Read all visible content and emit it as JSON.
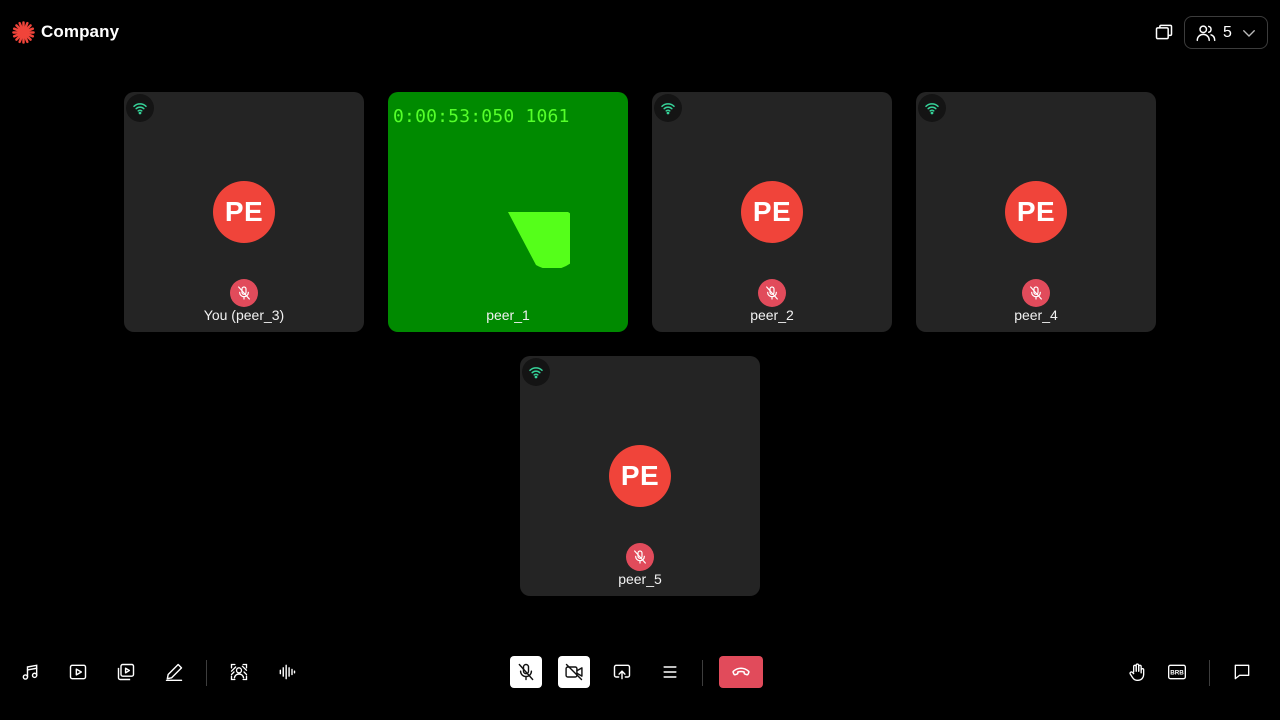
{
  "brand": {
    "name": "Company",
    "logo_icon": "asterisk-logo-icon",
    "logo_color": "#f0443a"
  },
  "header": {
    "pip_icon": "picture-in-picture-icon",
    "participants_icon": "people-icon",
    "participant_count": "5",
    "chevron_icon": "chevron-down-icon"
  },
  "tiles": [
    {
      "name": "You (peer_3)",
      "initials": "PE",
      "muted": true,
      "video": false
    },
    {
      "name": "peer_1",
      "video": true,
      "timecode": "0:00:53:050 1061",
      "video_bg": "#008a00",
      "shape_color": "#55ff1a"
    },
    {
      "name": "peer_2",
      "initials": "PE",
      "muted": true,
      "video": false
    },
    {
      "name": "peer_4",
      "initials": "PE",
      "muted": true,
      "video": false
    },
    {
      "name": "peer_5",
      "initials": "PE",
      "muted": true,
      "video": false
    }
  ],
  "colors": {
    "avatar_bg": "#f0443a",
    "mute_badge": "#e14b5b",
    "signal_good": "#36d399",
    "tile_bg": "#242424",
    "leave_button": "#e14b5b"
  },
  "toolbar": {
    "left": [
      {
        "icon": "music-note-icon"
      },
      {
        "icon": "play-video-icon"
      },
      {
        "icon": "playlist-video-icon"
      },
      {
        "icon": "whiteboard-pencil-icon"
      },
      {
        "icon": "virtual-background-icon"
      },
      {
        "icon": "noise-suppression-icon"
      }
    ],
    "center": [
      {
        "icon": "mic-off-icon",
        "state": "muted"
      },
      {
        "icon": "video-off-icon",
        "state": "off"
      },
      {
        "icon": "screen-share-icon"
      },
      {
        "icon": "menu-icon"
      },
      {
        "icon": "leave-call-icon"
      }
    ],
    "right": [
      {
        "icon": "raise-hand-icon"
      },
      {
        "icon": "brb-icon",
        "label": "BRB"
      },
      {
        "icon": "chat-icon"
      }
    ]
  }
}
